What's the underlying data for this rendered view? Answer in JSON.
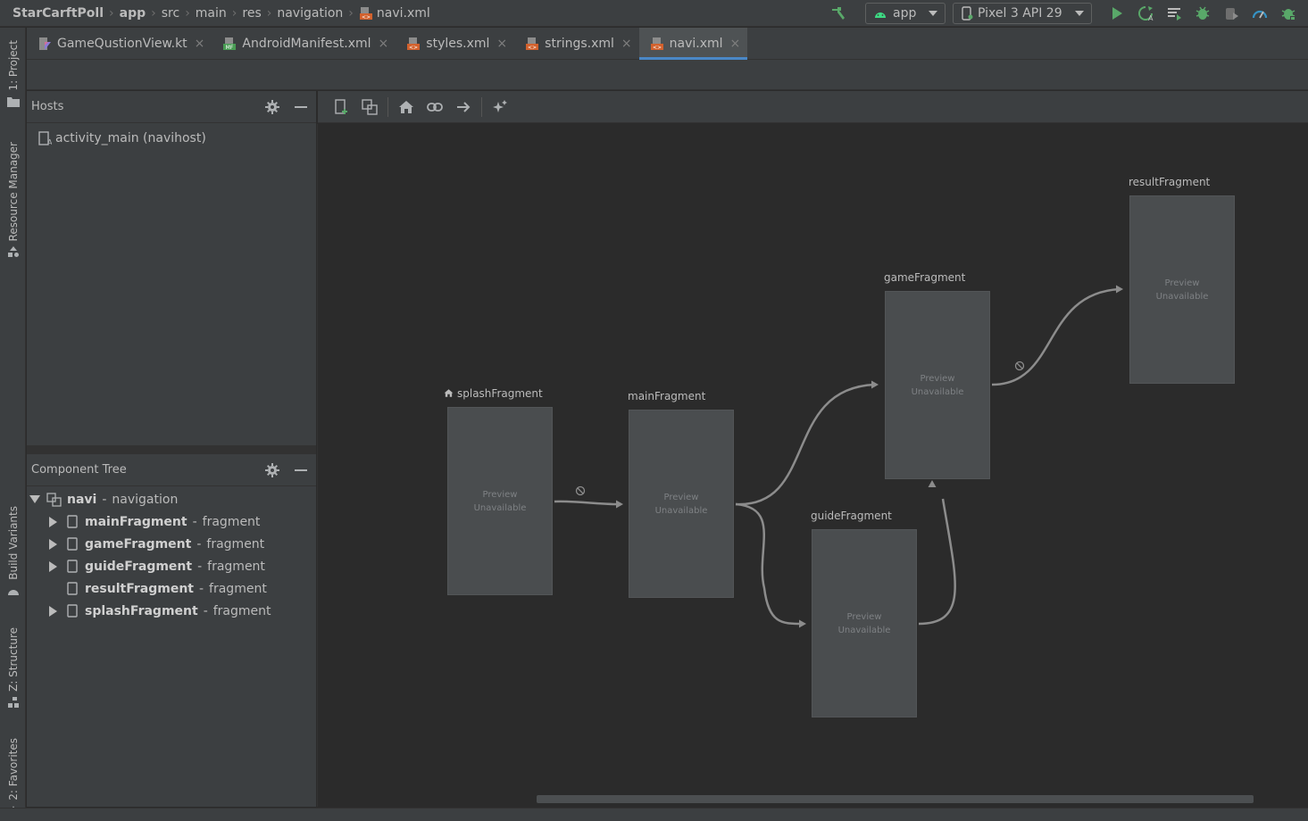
{
  "breadcrumbs": [
    {
      "label": "StarCarftPoll",
      "bold": true
    },
    {
      "label": "app",
      "bold": true
    },
    {
      "label": "src",
      "bold": false
    },
    {
      "label": "main",
      "bold": false
    },
    {
      "label": "res",
      "bold": false
    },
    {
      "label": "navigation",
      "bold": false
    },
    {
      "label": "navi.xml",
      "bold": false,
      "icon": "xml-file-icon"
    }
  ],
  "run_toolbar": {
    "config_label": "app",
    "device_label": "Pixel 3 API 29",
    "icons": [
      "hammer-build-icon",
      "run-icon",
      "apply-changes-icon",
      "apply-code-changes-icon",
      "debug-icon",
      "attach-debugger-icon",
      "profile-icon",
      "bug-icon"
    ]
  },
  "left_tool_windows": [
    {
      "label": "1: Project",
      "icon": "folder-icon"
    },
    {
      "label": "Resource Manager",
      "icon": "resource-icon"
    },
    {
      "label": "Build Variants",
      "icon": "android-icon"
    },
    {
      "label": "Z: Structure",
      "icon": "structure-icon"
    },
    {
      "label": "2: Favorites",
      "icon": "star-icon"
    }
  ],
  "editor_tabs": [
    {
      "label": "GameQustionView.kt",
      "icon": "kotlin-file-icon",
      "active": false
    },
    {
      "label": "AndroidManifest.xml",
      "icon": "manifest-file-icon",
      "active": false
    },
    {
      "label": "styles.xml",
      "icon": "xml-file-icon",
      "active": false
    },
    {
      "label": "strings.xml",
      "icon": "xml-file-icon",
      "active": false
    },
    {
      "label": "navi.xml",
      "icon": "xml-file-icon",
      "active": true
    }
  ],
  "hosts": {
    "title": "Hosts",
    "item": "activity_main (navihost)"
  },
  "component_tree": {
    "title": "Component Tree",
    "root": {
      "name": "navi",
      "type": "navigation"
    },
    "children": [
      {
        "name": "mainFragment",
        "type": "fragment",
        "expandable": true
      },
      {
        "name": "gameFragment",
        "type": "fragment",
        "expandable": true
      },
      {
        "name": "guideFragment",
        "type": "fragment",
        "expandable": true
      },
      {
        "name": "resultFragment",
        "type": "fragment",
        "expandable": false
      },
      {
        "name": "splashFragment",
        "type": "fragment",
        "expandable": true
      }
    ],
    "separator": "-"
  },
  "design_toolbar": {
    "icons": [
      "new-destination-icon",
      "nested-graph-icon",
      "assign-start-icon",
      "add-deep-link-icon",
      "add-action-icon",
      "auto-arrange-icon"
    ]
  },
  "graph": {
    "preview_line1": "Preview",
    "preview_line2": "Unavailable",
    "fragments": [
      {
        "id": "splash",
        "name": "splashFragment",
        "is_start": true
      },
      {
        "id": "main",
        "name": "mainFragment",
        "is_start": false
      },
      {
        "id": "game",
        "name": "gameFragment",
        "is_start": false
      },
      {
        "id": "guide",
        "name": "guideFragment",
        "is_start": false
      },
      {
        "id": "result",
        "name": "resultFragment",
        "is_start": false
      }
    ],
    "actions": [
      {
        "from": "splash",
        "to": "main",
        "pop_marker": true
      },
      {
        "from": "main",
        "to": "game",
        "pop_marker": false
      },
      {
        "from": "main",
        "to": "guide",
        "pop_marker": false
      },
      {
        "from": "guide",
        "to": "game",
        "pop_marker": false
      },
      {
        "from": "game",
        "to": "result",
        "pop_marker": true
      }
    ]
  }
}
